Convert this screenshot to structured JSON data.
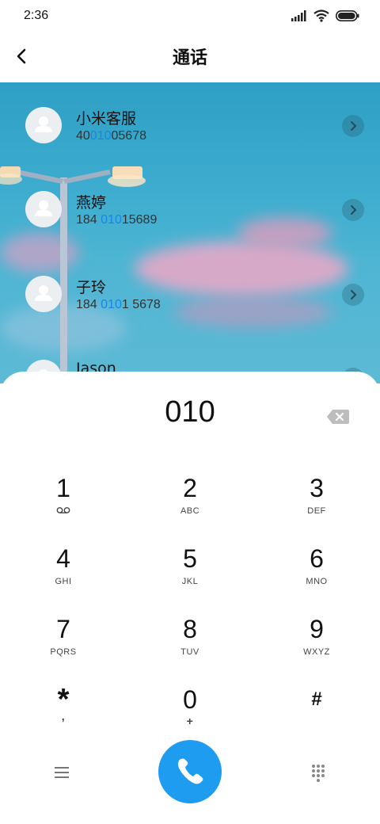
{
  "status_bar": {
    "time": "2:36",
    "icons": [
      "signal-icon",
      "wifi-icon",
      "battery-icon"
    ]
  },
  "header": {
    "title": "通话",
    "back_icon": "back-arrow-icon"
  },
  "contacts": [
    {
      "name": "小米客服",
      "number_pre": "40",
      "number_match": "010",
      "number_post": "05678"
    },
    {
      "name": "燕婷",
      "number_pre": "184 ",
      "number_match": "010",
      "number_post": "15689"
    },
    {
      "name": "子玲",
      "number_pre": "184 ",
      "number_match": "010",
      "number_post": "1 5678"
    },
    {
      "name": "Jason",
      "number_pre": "",
      "number_match": "",
      "number_post": ""
    }
  ],
  "dialer": {
    "input_value": "010",
    "keys": [
      {
        "digit": "1",
        "letters": ""
      },
      {
        "digit": "2",
        "letters": "ABC"
      },
      {
        "digit": "3",
        "letters": "DEF"
      },
      {
        "digit": "4",
        "letters": "GHI"
      },
      {
        "digit": "5",
        "letters": "JKL"
      },
      {
        "digit": "6",
        "letters": "MNO"
      },
      {
        "digit": "7",
        "letters": "PQRS"
      },
      {
        "digit": "8",
        "letters": "TUV"
      },
      {
        "digit": "9",
        "letters": "WXYZ"
      },
      {
        "digit": "*",
        "letters": ","
      },
      {
        "digit": "0",
        "letters": "+"
      },
      {
        "digit": "#",
        "letters": ""
      }
    ]
  },
  "colors": {
    "accent": "#1e9cf0",
    "match_highlight": "#1a86e3",
    "sky": "#3daccf",
    "cloud_pink": "#e9a9c6"
  }
}
